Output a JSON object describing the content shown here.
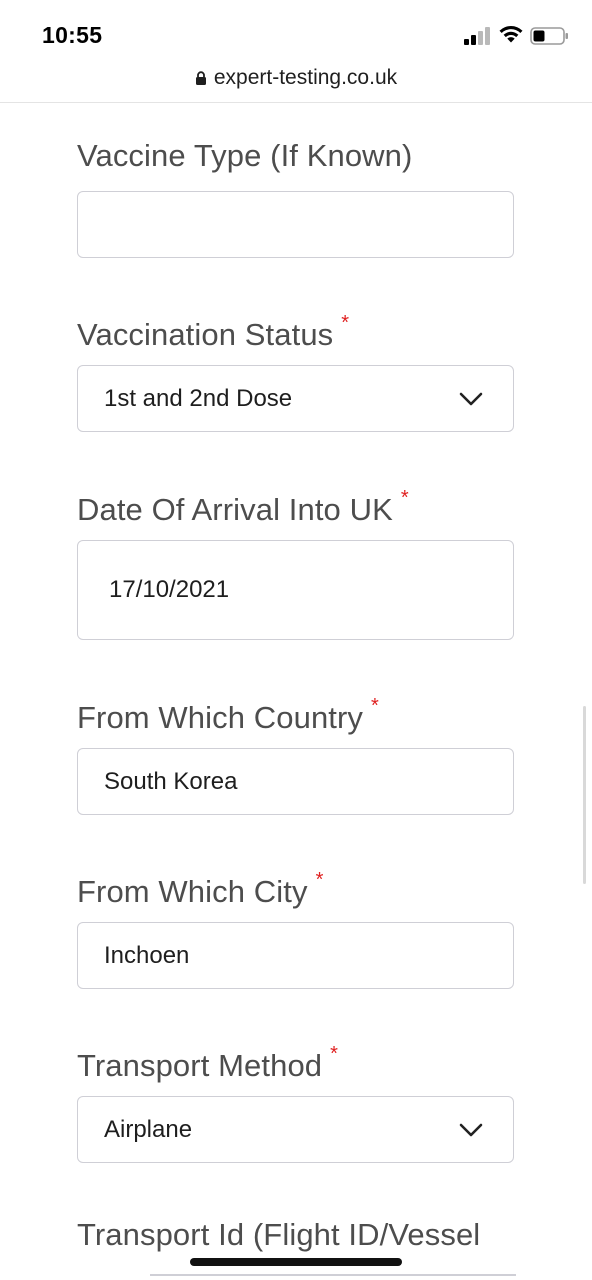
{
  "status_bar": {
    "time": "10:55",
    "signal_icon": "cellular-signal-icon",
    "wifi_icon": "wifi-icon",
    "battery_icon": "battery-icon"
  },
  "browser": {
    "url": "expert-testing.co.uk",
    "lock_icon": "lock-icon"
  },
  "form": {
    "vaccine_type": {
      "label": "Vaccine Type (If Known)",
      "value": ""
    },
    "vaccination_status": {
      "label": "Vaccination Status",
      "required_mark": "*",
      "value": "1st and 2nd Dose"
    },
    "arrival_date": {
      "label": "Date Of Arrival Into UK",
      "required_mark": "*",
      "value": "17/10/2021"
    },
    "from_country": {
      "label": "From Which Country",
      "required_mark": "*",
      "value": "South Korea"
    },
    "from_city": {
      "label": "From Which City",
      "required_mark": "*",
      "value": "Inchoen"
    },
    "transport_method": {
      "label": "Transport Method",
      "required_mark": "*",
      "value": "Airplane"
    },
    "transport_id": {
      "label": "Transport Id (Flight ID/Vessel"
    }
  },
  "colors": {
    "required": "#e02020",
    "label_text": "#4d4d4d",
    "border": "#cfcfd6"
  }
}
